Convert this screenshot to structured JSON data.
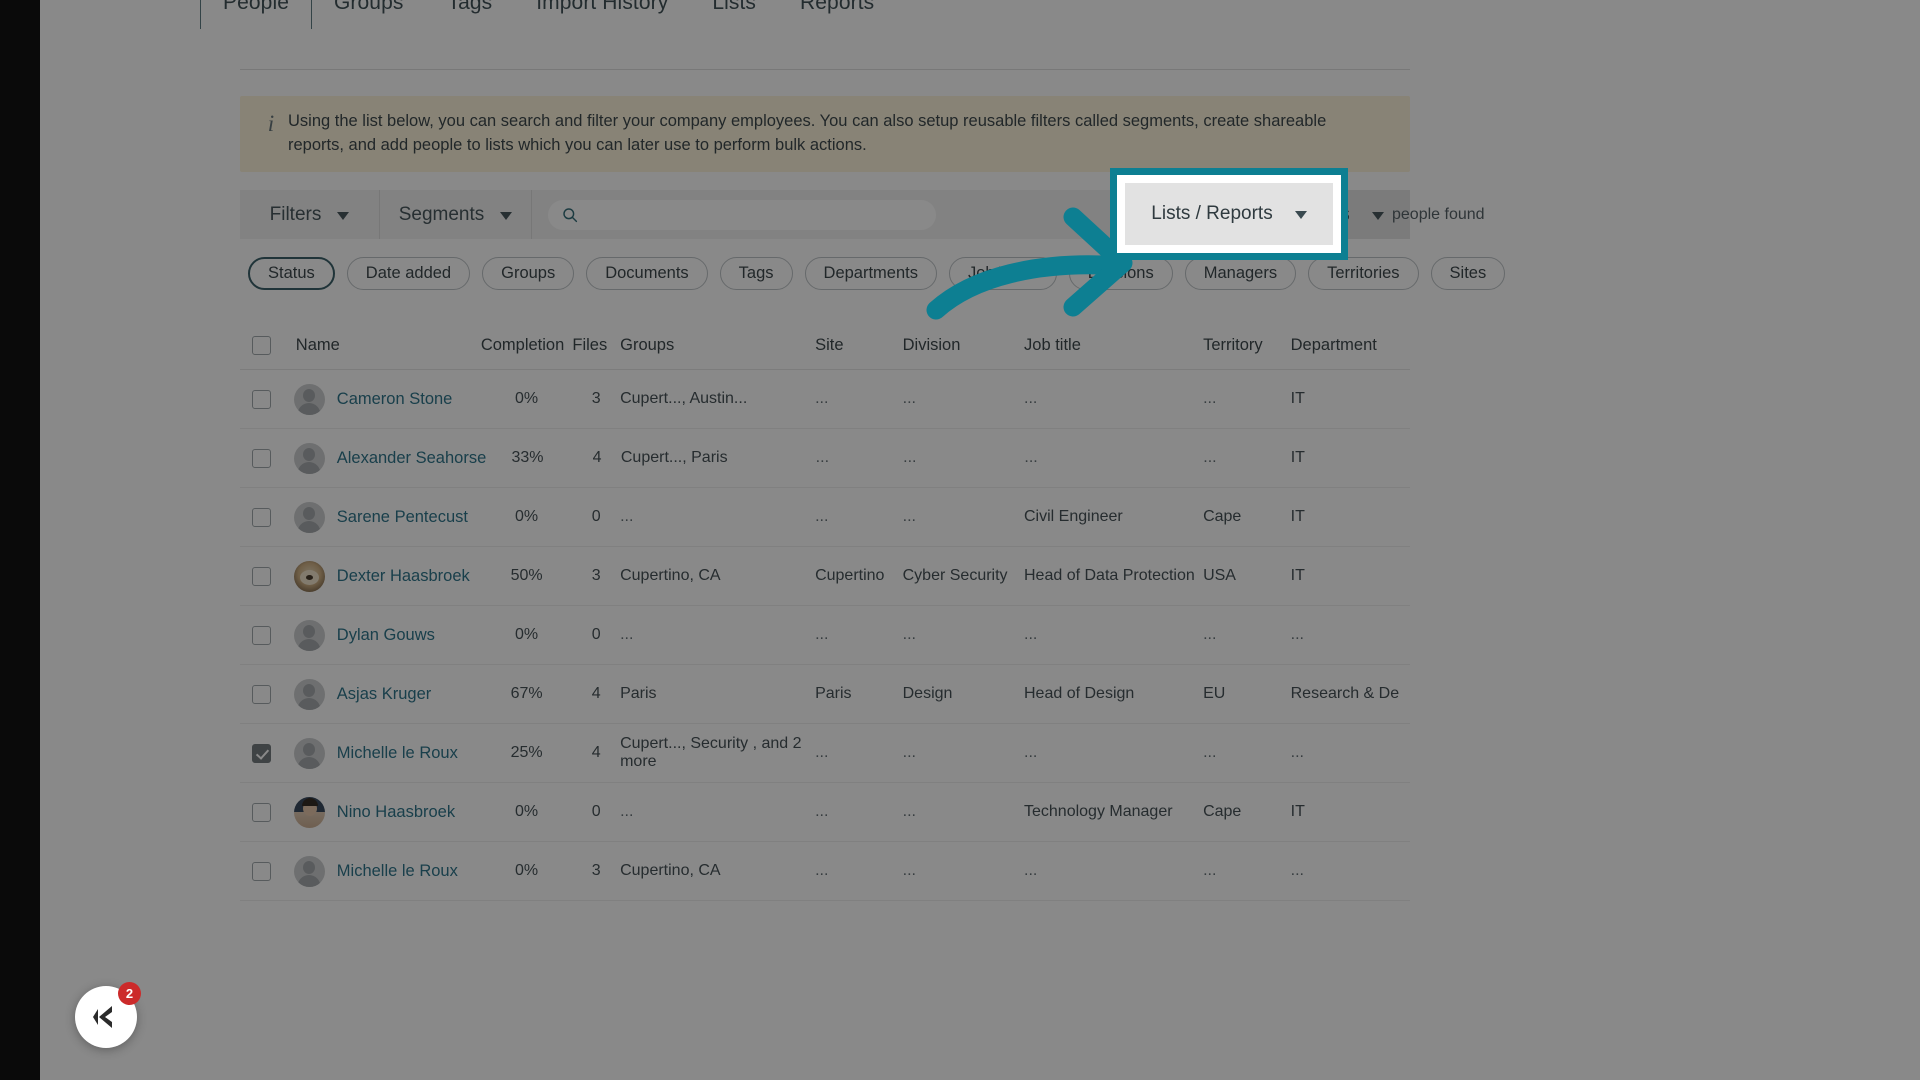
{
  "app": {
    "tabs": [
      {
        "label": "People",
        "active": true
      },
      {
        "label": "Groups",
        "active": false
      },
      {
        "label": "Tags",
        "active": false
      },
      {
        "label": "Import History",
        "active": false
      },
      {
        "label": "Lists",
        "active": false
      },
      {
        "label": "Reports",
        "active": false
      }
    ]
  },
  "banner": {
    "icon": "info-icon",
    "text": "Using the list below, you can search and filter your company employees. You can also setup reusable filters called segments, create shareable reports, and add people to lists which you can later use to perform bulk actions."
  },
  "toolbar": {
    "filters_label": "Filters",
    "segments_label": "Segments",
    "search_placeholder": "",
    "search_value": "",
    "results_text": "people found",
    "lists_reports_label": "Lists / Reports"
  },
  "chips": [
    {
      "label": "Status",
      "active": true
    },
    {
      "label": "Date added",
      "active": false
    },
    {
      "label": "Groups",
      "active": false
    },
    {
      "label": "Documents",
      "active": false
    },
    {
      "label": "Tags",
      "active": false
    },
    {
      "label": "Departments",
      "active": false
    },
    {
      "label": "Job Titles",
      "active": false
    },
    {
      "label": "Divisions",
      "active": false
    },
    {
      "label": "Managers",
      "active": false
    },
    {
      "label": "Territories",
      "active": false
    },
    {
      "label": "Sites",
      "active": false
    }
  ],
  "table": {
    "headers": {
      "name": "Name",
      "completion": "Completion",
      "files": "Files",
      "groups": "Groups",
      "site": "Site",
      "division": "Division",
      "job_title": "Job title",
      "territory": "Territory",
      "department": "Department"
    },
    "select_all_checked": false,
    "rows": [
      {
        "checked": false,
        "avatar": "placeholder",
        "name": "Cameron Stone",
        "completion": "0%",
        "files": "3",
        "groups": "Cupert..., Austin...",
        "site": "...",
        "division": "...",
        "job_title": "...",
        "territory": "...",
        "department": "IT"
      },
      {
        "checked": false,
        "avatar": "placeholder",
        "name": "Alexander Seahorse",
        "completion": "33%",
        "files": "4",
        "groups": "Cupert..., Paris",
        "site": "...",
        "division": "...",
        "job_title": "...",
        "territory": "...",
        "department": "IT"
      },
      {
        "checked": false,
        "avatar": "placeholder",
        "name": "Sarene Pentecust",
        "completion": "0%",
        "files": "0",
        "groups": "...",
        "site": "...",
        "division": "...",
        "job_title": "Civil Engineer",
        "territory": "Cape",
        "department": "IT"
      },
      {
        "checked": false,
        "avatar": "photo-dog",
        "name": "Dexter Haasbroek",
        "completion": "50%",
        "files": "3",
        "groups": "Cupertino, CA",
        "site": "Cupertino",
        "division": "Cyber Security",
        "job_title": "Head of Data Protection",
        "territory": "USA",
        "department": "IT"
      },
      {
        "checked": false,
        "avatar": "placeholder",
        "name": "Dylan Gouws",
        "completion": "0%",
        "files": "0",
        "groups": "...",
        "site": "...",
        "division": "...",
        "job_title": "...",
        "territory": "...",
        "department": "..."
      },
      {
        "checked": false,
        "avatar": "placeholder",
        "name": "Asjas Kruger",
        "completion": "67%",
        "files": "4",
        "groups": "Paris",
        "site": "Paris",
        "division": "Design",
        "job_title": "Head of Design",
        "territory": "EU",
        "department": "Research & De"
      },
      {
        "checked": true,
        "avatar": "placeholder",
        "name": "Michelle le Roux",
        "completion": "25%",
        "files": "4",
        "groups": "Cupert..., Security , and 2 more",
        "site": "...",
        "division": "...",
        "job_title": "...",
        "territory": "...",
        "department": "..."
      },
      {
        "checked": false,
        "avatar": "photo-man",
        "name": "Nino Haasbroek",
        "completion": "0%",
        "files": "0",
        "groups": "...",
        "site": "...",
        "division": "...",
        "job_title": "Technology Manager",
        "territory": "Cape",
        "department": "IT"
      },
      {
        "checked": false,
        "avatar": "placeholder",
        "name": "Michelle le Roux",
        "completion": "0%",
        "files": "3",
        "groups": "Cupertino, CA",
        "site": "...",
        "division": "...",
        "job_title": "...",
        "territory": "...",
        "department": "..."
      }
    ]
  },
  "chat": {
    "icon": "chat-widget-icon",
    "badge_count": "2"
  },
  "annotation": {
    "highlight_target": "Lists / Reports",
    "arrow": "curved-arrow-right",
    "accent_color": "#0d7f92"
  }
}
